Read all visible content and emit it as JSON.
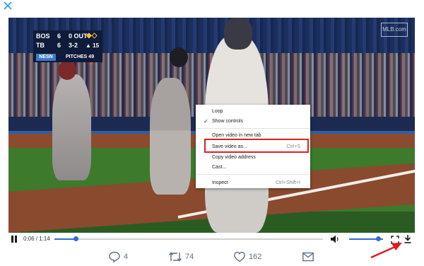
{
  "scoreboard": {
    "away": {
      "team": "BOS",
      "runs": "6"
    },
    "home": {
      "team": "TB",
      "runs": "6"
    },
    "outs": "0 OUT",
    "count": "3-2",
    "arrow": "▲",
    "inning": "15",
    "network": "NESN",
    "pitches_label": "PITCHES",
    "pitches": "49",
    "watermark": "MLB.com"
  },
  "context_menu": {
    "items": [
      {
        "label": "Loop",
        "shortcut": "",
        "checked": false
      },
      {
        "label": "Show controls",
        "shortcut": "",
        "checked": true
      },
      {
        "label": "Open video in new tab",
        "shortcut": "",
        "checked": false
      },
      {
        "label": "Save video as...",
        "shortcut": "Ctrl+S",
        "checked": false,
        "highlighted": true
      },
      {
        "label": "Copy video address",
        "shortcut": "",
        "checked": false
      },
      {
        "label": "Cast...",
        "shortcut": "",
        "checked": false
      },
      {
        "label": "Inspect",
        "shortcut": "Ctrl+Shift+I",
        "checked": false
      }
    ]
  },
  "player": {
    "time": "0:06 / 1:14",
    "progress": 0.08,
    "volume": 0.8
  },
  "actions": {
    "replies": "4",
    "retweets": "74",
    "likes": "162"
  },
  "colors": {
    "accent": "#2f6ec9",
    "highlight_box": "#d92124",
    "action_icon": "#5b7083"
  }
}
